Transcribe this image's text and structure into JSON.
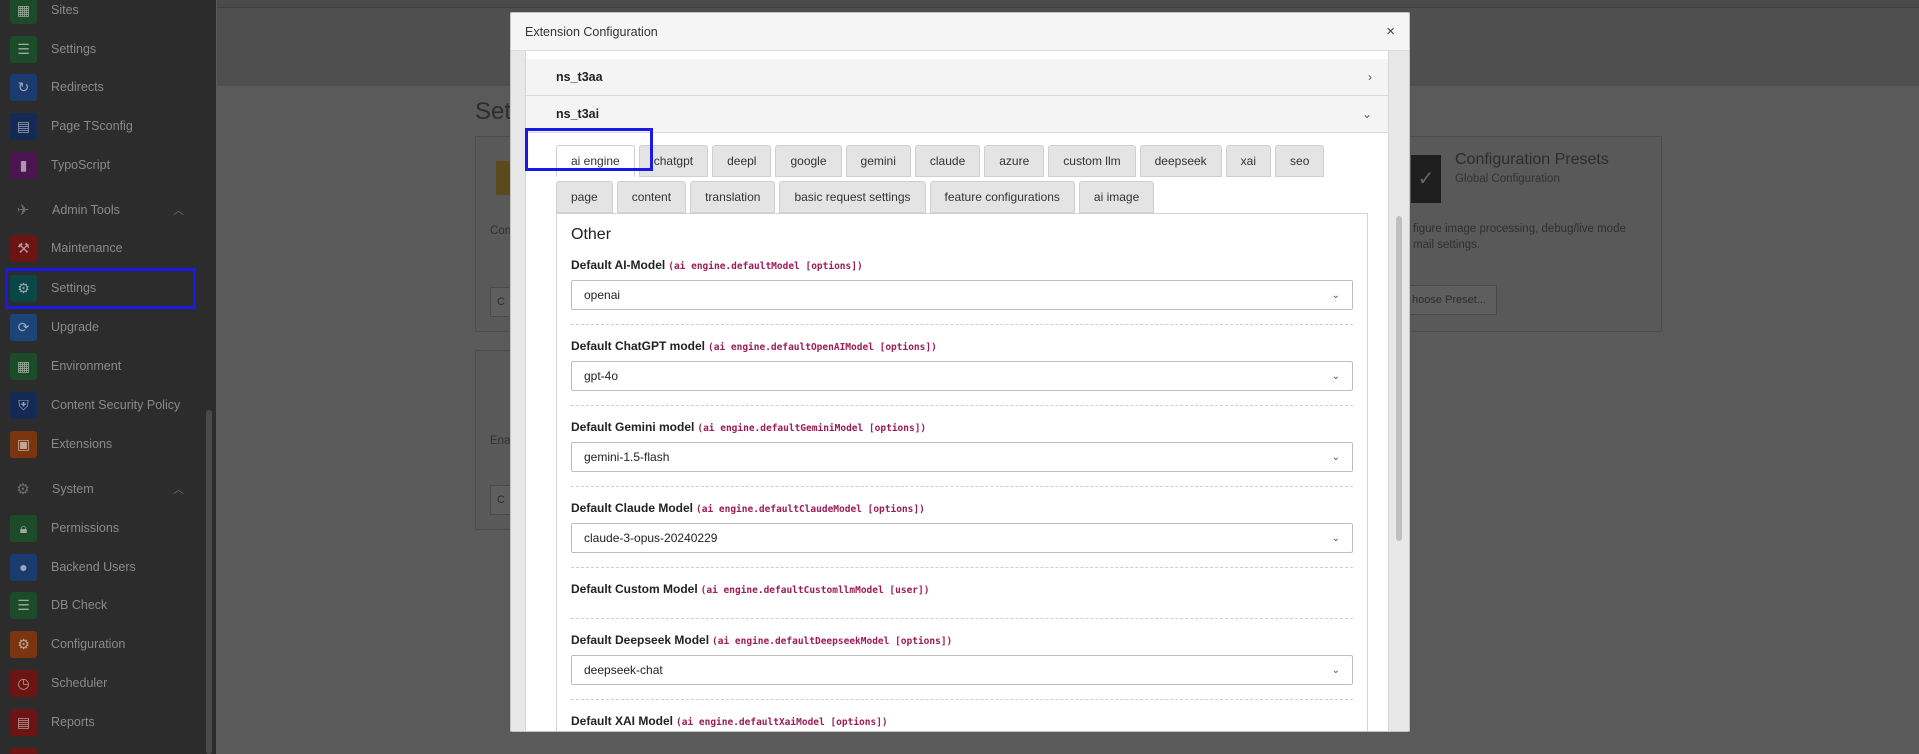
{
  "sidebar": {
    "items": [
      {
        "label": "Sites",
        "icon": "sites-icon",
        "color": "#2f7d3f"
      },
      {
        "label": "Settings",
        "icon": "settings-icon",
        "color": "#2f7d3f"
      },
      {
        "label": "Redirects",
        "icon": "redirects-icon",
        "color": "#2b5fb4"
      },
      {
        "label": "Page TSconfig",
        "icon": "page-tsconfig-icon",
        "color": "#1f3f8a"
      },
      {
        "label": "TypoScript",
        "icon": "typoscript-icon",
        "color": "#7a1f80"
      }
    ],
    "admin_group": {
      "label": "Admin Tools"
    },
    "admin_items": [
      {
        "label": "Maintenance",
        "icon": "wrench-icon",
        "color": "#b21d1d"
      },
      {
        "label": "Settings",
        "icon": "gear-icon",
        "color": "#0d6b70"
      },
      {
        "label": "Upgrade",
        "icon": "upgrade-icon",
        "color": "#2b6fb4"
      },
      {
        "label": "Environment",
        "icon": "environment-icon",
        "color": "#2f7d3f"
      },
      {
        "label": "Content Security Policy",
        "icon": "shield-icon",
        "color": "#1f3f8a"
      },
      {
        "label": "Extensions",
        "icon": "extensions-icon",
        "color": "#d05a1a"
      }
    ],
    "system_group": {
      "label": "System"
    },
    "system_items": [
      {
        "label": "Permissions",
        "icon": "lock-icon",
        "color": "#2f7d3f"
      },
      {
        "label": "Backend Users",
        "icon": "user-icon",
        "color": "#2b5fb4"
      },
      {
        "label": "DB Check",
        "icon": "db-icon",
        "color": "#2f7d3f"
      },
      {
        "label": "Configuration",
        "icon": "configuration-icon",
        "color": "#d05a1a"
      },
      {
        "label": "Scheduler",
        "icon": "scheduler-icon",
        "color": "#b21d1d"
      },
      {
        "label": "Reports",
        "icon": "reports-icon",
        "color": "#b21d1d"
      }
    ]
  },
  "main": {
    "title": "Set",
    "card1_text": "Con",
    "card1_btn": "C",
    "card2_text": "Ena",
    "card2_btn": "C",
    "presets_title": "Configuration Presets",
    "presets_sub": "Global Configuration",
    "presets_text_1": "figure image processing, debug/live mode",
    "presets_text_2": "mail settings.",
    "presets_btn": "hoose Preset..."
  },
  "modal": {
    "title": "Extension Configuration",
    "close": "×",
    "accordion": [
      {
        "label": "ns_t3aa",
        "chevron": "›"
      },
      {
        "label": "ns_t3ai",
        "chevron": "⌄"
      }
    ],
    "tabs_row1": [
      "ai engine",
      "chatgpt",
      "deepl",
      "google",
      "gemini",
      "claude",
      "azure",
      "custom llm",
      "deepseek",
      "xai",
      "seo",
      "page"
    ],
    "tabs_row2": [
      "content",
      "translation",
      "basic request settings",
      "feature configurations",
      "ai image"
    ],
    "active_tab": "ai engine",
    "panel_heading": "Other",
    "fields": [
      {
        "label": "Default AI-Model",
        "key": "(ai engine.defaultModel [options])",
        "value": "openai"
      },
      {
        "label": "Default ChatGPT model",
        "key": "(ai engine.defaultOpenAIModel [options])",
        "value": "gpt-4o"
      },
      {
        "label": "Default Gemini model",
        "key": "(ai engine.defaultGeminiModel [options])",
        "value": "gemini-1.5-flash"
      },
      {
        "label": "Default Claude Model",
        "key": "(ai engine.defaultClaudeModel [options])",
        "value": "claude-3-opus-20240229"
      },
      {
        "label": "Default Custom Model",
        "key": "(ai engine.defaultCustomllmModel [user])",
        "value": null
      },
      {
        "label": "Default Deepseek Model",
        "key": "(ai engine.defaultDeepseekModel [options])",
        "value": "deepseek-chat"
      },
      {
        "label": "Default XAI Model",
        "key": "(ai engine.defaultXaiModel [options])",
        "value": null
      }
    ]
  }
}
